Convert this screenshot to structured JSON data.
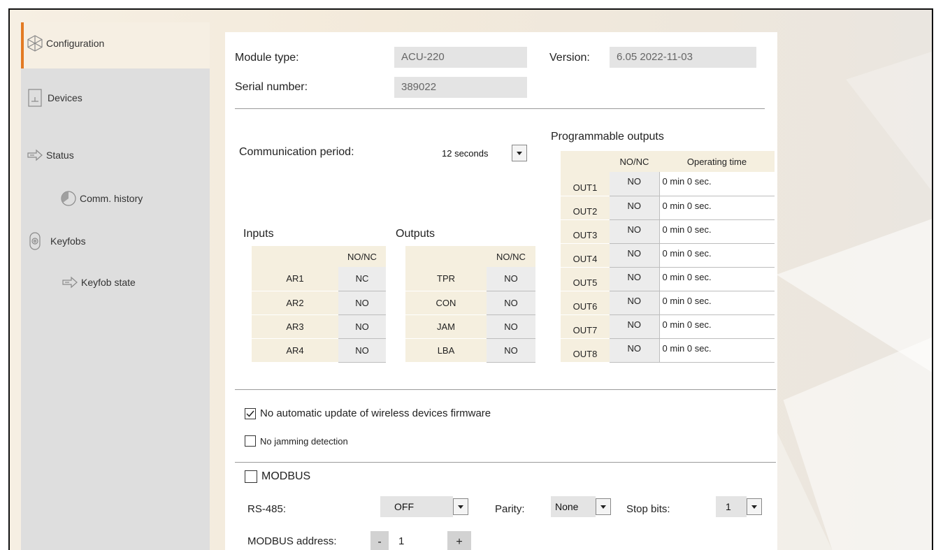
{
  "sidebar": {
    "items": [
      {
        "label": "Configuration",
        "icon": "configuration-icon",
        "active": true
      },
      {
        "label": "Devices",
        "icon": "devices-icon"
      },
      {
        "label": "Status",
        "icon": "status-icon"
      },
      {
        "label": "Comm. history",
        "icon": "comm-history-icon"
      },
      {
        "label": "Keyfobs",
        "icon": "keyfobs-icon"
      },
      {
        "label": "Keyfob state",
        "icon": "keyfob-state-icon"
      }
    ]
  },
  "module": {
    "type_label": "Module type:",
    "type_value": "ACU-220",
    "version_label": "Version:",
    "version_value": "6.05 2022-11-03",
    "serial_label": "Serial number:",
    "serial_value": "389022"
  },
  "comm": {
    "label": "Communication period:",
    "value": "12 seconds"
  },
  "inputs": {
    "title": "Inputs",
    "header": "NO/NC",
    "rows": [
      {
        "name": "AR1",
        "value": "NC"
      },
      {
        "name": "AR2",
        "value": "NO"
      },
      {
        "name": "AR3",
        "value": "NO"
      },
      {
        "name": "AR4",
        "value": "NO"
      }
    ]
  },
  "outputs": {
    "title": "Outputs",
    "header": "NO/NC",
    "rows": [
      {
        "name": "TPR",
        "value": "NO"
      },
      {
        "name": "CON",
        "value": "NO"
      },
      {
        "name": "JAM",
        "value": "NO"
      },
      {
        "name": "LBA",
        "value": "NO"
      }
    ]
  },
  "prog_outputs": {
    "title": "Programmable outputs",
    "header_nonc": "NO/NC",
    "header_time": "Operating time",
    "rows": [
      {
        "name": "OUT1",
        "nonc": "NO",
        "time": "0 min 0 sec."
      },
      {
        "name": "OUT2",
        "nonc": "NO",
        "time": "0 min 0 sec."
      },
      {
        "name": "OUT3",
        "nonc": "NO",
        "time": "0 min 0 sec."
      },
      {
        "name": "OUT4",
        "nonc": "NO",
        "time": "0 min 0 sec."
      },
      {
        "name": "OUT5",
        "nonc": "NO",
        "time": "0 min 0 sec."
      },
      {
        "name": "OUT6",
        "nonc": "NO",
        "time": "0 min 0 sec."
      },
      {
        "name": "OUT7",
        "nonc": "NO",
        "time": "0 min 0 sec."
      },
      {
        "name": "OUT8",
        "nonc": "NO",
        "time": "0 min 0 sec."
      }
    ]
  },
  "options": {
    "no_auto_update": {
      "label": "No automatic update of wireless devices firmware",
      "checked": true
    },
    "no_jamming": {
      "label": "No jamming detection",
      "checked": false
    }
  },
  "modbus": {
    "label": "MODBUS",
    "checked": false,
    "rs485_label": "RS-485:",
    "rs485_value": "OFF",
    "parity_label": "Parity:",
    "parity_value": "None",
    "stopbits_label": "Stop bits:",
    "stopbits_value": "1",
    "address_label": "MODBUS address:",
    "address_value": "1",
    "minus": "-",
    "plus": "+"
  },
  "colors": {
    "accent": "#e37a23",
    "sidebar_bg": "#dedede",
    "header_cell": "#f5efdf",
    "value_cell": "#ececec"
  }
}
